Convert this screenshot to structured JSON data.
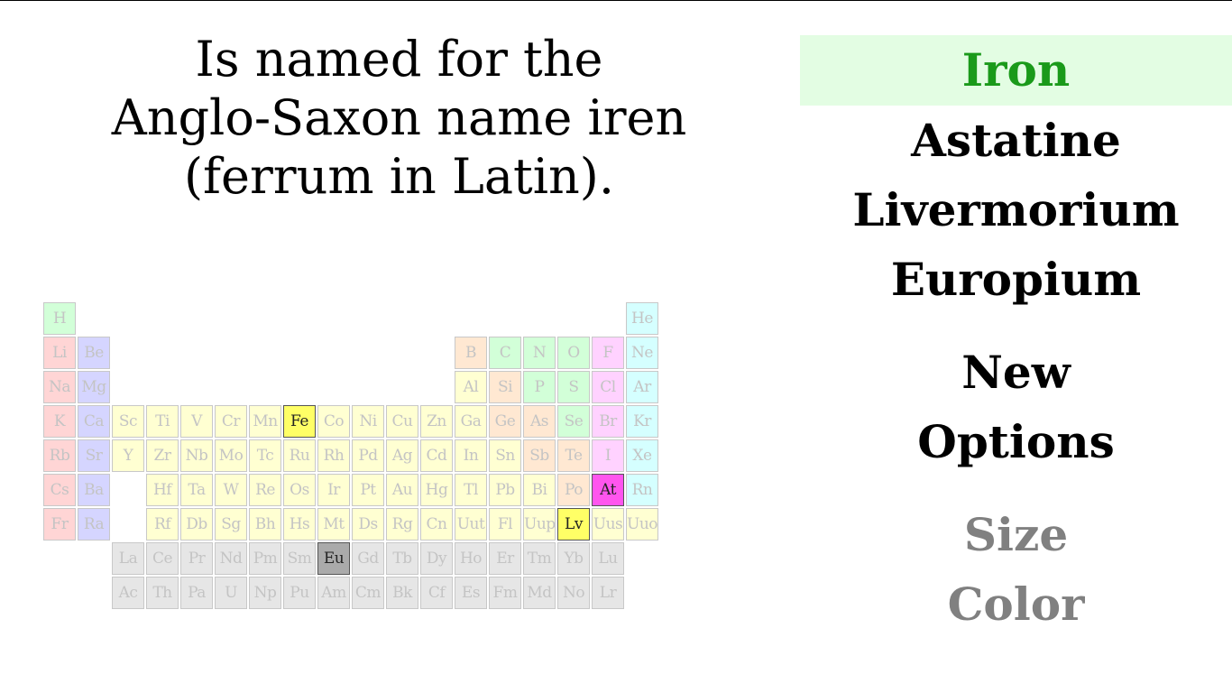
{
  "question": {
    "lines": [
      "Is named for the",
      "Anglo-Saxon name iren",
      "(ferrum in Latin)."
    ]
  },
  "answers": [
    {
      "label": "Iron",
      "state": "correct"
    },
    {
      "label": "Astatine",
      "state": "normal"
    },
    {
      "label": "Livermorium",
      "state": "normal"
    },
    {
      "label": "Europium",
      "state": "normal"
    }
  ],
  "menu": {
    "new_label": "New",
    "options_label": "Options",
    "size_label": "Size",
    "color_label": "Color"
  },
  "colors": {
    "correct_bg": "#e3fde3",
    "correct_text": "#1a9a1a",
    "dim_text": "#808080",
    "alkali": "#ffd5d5",
    "alkaline_earth": "#d5d5ff",
    "transition": "#ffffd2",
    "metalloid": "#ffe8d2",
    "nonmetal": "#d2ffd8",
    "halogen": "#ffd2ff",
    "noble_gas": "#d5ffff",
    "f_block": "#e6e6e6",
    "highlight_transition": "#ffff66",
    "highlight_halogen": "#ff55ee",
    "highlight_f_block": "#aaaaaa"
  },
  "periodic_table": {
    "rows": [
      [
        [
          "H",
          "nonmetal"
        ],
        null,
        null,
        null,
        null,
        null,
        null,
        null,
        null,
        null,
        null,
        null,
        null,
        null,
        null,
        null,
        null,
        [
          "He",
          "noble_gas"
        ]
      ],
      [
        [
          "Li",
          "alkali"
        ],
        [
          "Be",
          "alkaline_earth"
        ],
        null,
        null,
        null,
        null,
        null,
        null,
        null,
        null,
        null,
        null,
        [
          "B",
          "metalloid"
        ],
        [
          "C",
          "nonmetal"
        ],
        [
          "N",
          "nonmetal"
        ],
        [
          "O",
          "nonmetal"
        ],
        [
          "F",
          "halogen"
        ],
        [
          "Ne",
          "noble_gas"
        ]
      ],
      [
        [
          "Na",
          "alkali"
        ],
        [
          "Mg",
          "alkaline_earth"
        ],
        null,
        null,
        null,
        null,
        null,
        null,
        null,
        null,
        null,
        null,
        [
          "Al",
          "transition"
        ],
        [
          "Si",
          "metalloid"
        ],
        [
          "P",
          "nonmetal"
        ],
        [
          "S",
          "nonmetal"
        ],
        [
          "Cl",
          "halogen"
        ],
        [
          "Ar",
          "noble_gas"
        ]
      ],
      [
        [
          "K",
          "alkali"
        ],
        [
          "Ca",
          "alkaline_earth"
        ],
        [
          "Sc",
          "transition"
        ],
        [
          "Ti",
          "transition"
        ],
        [
          "V",
          "transition"
        ],
        [
          "Cr",
          "transition"
        ],
        [
          "Mn",
          "transition"
        ],
        [
          "Fe",
          "transition"
        ],
        [
          "Co",
          "transition"
        ],
        [
          "Ni",
          "transition"
        ],
        [
          "Cu",
          "transition"
        ],
        [
          "Zn",
          "transition"
        ],
        [
          "Ga",
          "transition"
        ],
        [
          "Ge",
          "metalloid"
        ],
        [
          "As",
          "metalloid"
        ],
        [
          "Se",
          "nonmetal"
        ],
        [
          "Br",
          "halogen"
        ],
        [
          "Kr",
          "noble_gas"
        ]
      ],
      [
        [
          "Rb",
          "alkali"
        ],
        [
          "Sr",
          "alkaline_earth"
        ],
        [
          "Y",
          "transition"
        ],
        [
          "Zr",
          "transition"
        ],
        [
          "Nb",
          "transition"
        ],
        [
          "Mo",
          "transition"
        ],
        [
          "Tc",
          "transition"
        ],
        [
          "Ru",
          "transition"
        ],
        [
          "Rh",
          "transition"
        ],
        [
          "Pd",
          "transition"
        ],
        [
          "Ag",
          "transition"
        ],
        [
          "Cd",
          "transition"
        ],
        [
          "In",
          "transition"
        ],
        [
          "Sn",
          "transition"
        ],
        [
          "Sb",
          "metalloid"
        ],
        [
          "Te",
          "metalloid"
        ],
        [
          "I",
          "halogen"
        ],
        [
          "Xe",
          "noble_gas"
        ]
      ],
      [
        [
          "Cs",
          "alkali"
        ],
        [
          "Ba",
          "alkaline_earth"
        ],
        null,
        [
          "Hf",
          "transition"
        ],
        [
          "Ta",
          "transition"
        ],
        [
          "W",
          "transition"
        ],
        [
          "Re",
          "transition"
        ],
        [
          "Os",
          "transition"
        ],
        [
          "Ir",
          "transition"
        ],
        [
          "Pt",
          "transition"
        ],
        [
          "Au",
          "transition"
        ],
        [
          "Hg",
          "transition"
        ],
        [
          "Tl",
          "transition"
        ],
        [
          "Pb",
          "transition"
        ],
        [
          "Bi",
          "transition"
        ],
        [
          "Po",
          "metalloid"
        ],
        [
          "At",
          "halogen"
        ],
        [
          "Rn",
          "noble_gas"
        ]
      ],
      [
        [
          "Fr",
          "alkali"
        ],
        [
          "Ra",
          "alkaline_earth"
        ],
        null,
        [
          "Rf",
          "transition"
        ],
        [
          "Db",
          "transition"
        ],
        [
          "Sg",
          "transition"
        ],
        [
          "Bh",
          "transition"
        ],
        [
          "Hs",
          "transition"
        ],
        [
          "Mt",
          "transition"
        ],
        [
          "Ds",
          "transition"
        ],
        [
          "Rg",
          "transition"
        ],
        [
          "Cn",
          "transition"
        ],
        [
          "Uut",
          "transition"
        ],
        [
          "Fl",
          "transition"
        ],
        [
          "Uup",
          "transition"
        ],
        [
          "Lv",
          "transition"
        ],
        [
          "Uus",
          "transition"
        ],
        [
          "Uuo",
          "transition"
        ]
      ],
      [
        null,
        null,
        [
          "La",
          "f_block"
        ],
        [
          "Ce",
          "f_block"
        ],
        [
          "Pr",
          "f_block"
        ],
        [
          "Nd",
          "f_block"
        ],
        [
          "Pm",
          "f_block"
        ],
        [
          "Sm",
          "f_block"
        ],
        [
          "Eu",
          "f_block"
        ],
        [
          "Gd",
          "f_block"
        ],
        [
          "Tb",
          "f_block"
        ],
        [
          "Dy",
          "f_block"
        ],
        [
          "Ho",
          "f_block"
        ],
        [
          "Er",
          "f_block"
        ],
        [
          "Tm",
          "f_block"
        ],
        [
          "Yb",
          "f_block"
        ],
        [
          "Lu",
          "f_block"
        ]
      ],
      [
        null,
        null,
        [
          "Ac",
          "f_block"
        ],
        [
          "Th",
          "f_block"
        ],
        [
          "Pa",
          "f_block"
        ],
        [
          "U",
          "f_block"
        ],
        [
          "Np",
          "f_block"
        ],
        [
          "Pu",
          "f_block"
        ],
        [
          "Am",
          "f_block"
        ],
        [
          "Cm",
          "f_block"
        ],
        [
          "Bk",
          "f_block"
        ],
        [
          "Cf",
          "f_block"
        ],
        [
          "Es",
          "f_block"
        ],
        [
          "Fm",
          "f_block"
        ],
        [
          "Md",
          "f_block"
        ],
        [
          "No",
          "f_block"
        ],
        [
          "Lr",
          "f_block"
        ]
      ]
    ],
    "highlighted": {
      "Fe": "highlight_transition",
      "At": "highlight_halogen",
      "Lv": "highlight_transition",
      "Eu": "highlight_f_block"
    }
  }
}
